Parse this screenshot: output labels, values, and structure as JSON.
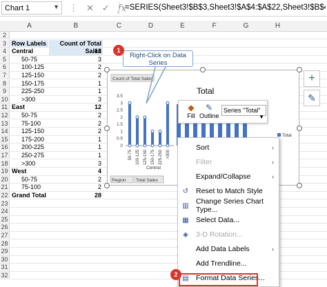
{
  "formula_bar": {
    "name_box": "Chart 1",
    "formula": "=SERIES(Sheet3!$B$3,Sheet3!$A$4:$A$22,Sheet3!$B$4:$B$22,1)",
    "fx": "fx"
  },
  "columns": [
    "A",
    "B",
    "C",
    "D",
    "E",
    "F",
    "G",
    "H"
  ],
  "rows": [
    {
      "num": "2",
      "a": "",
      "b": ""
    },
    {
      "num": "3",
      "a": "Row Labels",
      "b": "Count of Total Sales",
      "header": true
    },
    {
      "num": "4",
      "a": "Central",
      "b": "12",
      "bold": true
    },
    {
      "num": "5",
      "a": "50-75",
      "b": "3"
    },
    {
      "num": "6",
      "a": "100-125",
      "b": "2"
    },
    {
      "num": "7",
      "a": "125-150",
      "b": "2"
    },
    {
      "num": "8",
      "a": "150-175",
      "b": "1"
    },
    {
      "num": "9",
      "a": "225-250",
      "b": "1"
    },
    {
      "num": "10",
      "a": ">300",
      "b": "3"
    },
    {
      "num": "11",
      "a": "East",
      "b": "12",
      "bold": true
    },
    {
      "num": "12",
      "a": "50-75",
      "b": "2"
    },
    {
      "num": "13",
      "a": "75-100",
      "b": "2"
    },
    {
      "num": "14",
      "a": "125-150",
      "b": "2"
    },
    {
      "num": "15",
      "a": "175-200",
      "b": "1"
    },
    {
      "num": "16",
      "a": "200-225",
      "b": "1"
    },
    {
      "num": "17",
      "a": "250-275",
      "b": "1"
    },
    {
      "num": "18",
      "a": ">300",
      "b": "3"
    },
    {
      "num": "19",
      "a": "West",
      "b": "4",
      "bold": true
    },
    {
      "num": "20",
      "a": "50-75",
      "b": "2"
    },
    {
      "num": "21",
      "a": "75-100",
      "b": "2"
    },
    {
      "num": "22",
      "a": "Grand Total",
      "b": "28",
      "bold": true
    },
    {
      "num": "23",
      "a": "",
      "b": ""
    },
    {
      "num": "24",
      "a": "",
      "b": ""
    },
    {
      "num": "25",
      "a": "",
      "b": ""
    },
    {
      "num": "26",
      "a": "",
      "b": ""
    },
    {
      "num": "27",
      "a": "",
      "b": ""
    },
    {
      "num": "28",
      "a": "",
      "b": ""
    },
    {
      "num": "29",
      "a": "",
      "b": ""
    },
    {
      "num": "30",
      "a": "",
      "b": ""
    },
    {
      "num": "31",
      "a": "",
      "b": ""
    },
    {
      "num": "32",
      "a": "",
      "b": ""
    }
  ],
  "chart": {
    "title": "Total",
    "legend": "Total",
    "field_button": "Count of Total Sales",
    "region_label": "Region",
    "total_sales_label": "Total Sales",
    "group_label": "Central",
    "y_ticks": [
      "3.5",
      "3",
      "2.5",
      "2",
      "1.5",
      "1",
      "0.5",
      "0"
    ]
  },
  "chart_data": {
    "type": "bar",
    "title": "Total",
    "categories": [
      "50-75",
      "100-125",
      "125-150",
      "150-175",
      "225-250",
      ">300"
    ],
    "values": [
      3,
      2,
      2,
      1,
      1,
      3
    ],
    "ylim": [
      0,
      3.5
    ],
    "legend": "Total"
  },
  "mini_toolbar": {
    "fill": "Fill",
    "outline": "Outline",
    "series_select": "Series \"Total\""
  },
  "context_menu": [
    {
      "label": "Sort",
      "icon": "",
      "arrow": true,
      "disabled": false
    },
    {
      "label": "Filter",
      "icon": "",
      "arrow": true,
      "disabled": true
    },
    {
      "label": "Expand/Collapse",
      "icon": "",
      "arrow": true,
      "disabled": false
    },
    {
      "label": "Reset to Match Style",
      "icon": "reset-icon",
      "arrow": false,
      "disabled": false
    },
    {
      "label": "Change Series Chart Type...",
      "icon": "chart-type-icon",
      "arrow": false,
      "disabled": false
    },
    {
      "label": "Select Data...",
      "icon": "select-data-icon",
      "arrow": false,
      "disabled": false
    },
    {
      "label": "3-D Rotation...",
      "icon": "rotation-icon",
      "arrow": false,
      "disabled": true
    },
    {
      "label": "Add Data Labels",
      "icon": "",
      "arrow": true,
      "disabled": false
    },
    {
      "label": "Add Trendline...",
      "icon": "",
      "arrow": false,
      "disabled": false
    },
    {
      "label": "Format Data Series...",
      "icon": "format-icon",
      "arrow": false,
      "disabled": false
    }
  ],
  "callouts": {
    "step1_num": "1",
    "step1_text": "Right-Click on Data Series",
    "step2_num": "2"
  },
  "colors": {
    "accent": "#d9342b",
    "bar": "#4472c4",
    "callout_border": "#7ba3d4"
  }
}
